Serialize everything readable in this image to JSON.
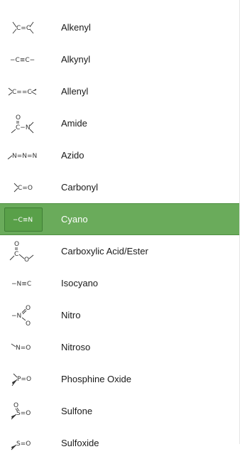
{
  "list": {
    "selected_index": 6,
    "items": [
      {
        "label": "Alkenyl",
        "icon": "alkenyl-icon"
      },
      {
        "label": "Alkynyl",
        "icon": "alkynyl-icon"
      },
      {
        "label": "Allenyl",
        "icon": "allenyl-icon"
      },
      {
        "label": "Amide",
        "icon": "amide-icon"
      },
      {
        "label": "Azido",
        "icon": "azido-icon"
      },
      {
        "label": "Carbonyl",
        "icon": "carbonyl-icon"
      },
      {
        "label": "Cyano",
        "icon": "cyano-icon"
      },
      {
        "label": "Carboxylic Acid/Ester",
        "icon": "carboxylic-acid-ester-icon"
      },
      {
        "label": "Isocyano",
        "icon": "isocyano-icon"
      },
      {
        "label": "Nitro",
        "icon": "nitro-icon"
      },
      {
        "label": "Nitroso",
        "icon": "nitroso-icon"
      },
      {
        "label": "Phosphine Oxide",
        "icon": "phosphine-oxide-icon"
      },
      {
        "label": "Sulfone",
        "icon": "sulfone-icon"
      },
      {
        "label": "Sulfoxide",
        "icon": "sulfoxide-icon"
      }
    ]
  },
  "icon_text": {
    "alkenyl": "C=C",
    "alkynyl": "−C≡C−",
    "allenyl": "C==C",
    "amide_o": "O",
    "amide_main": "C−N",
    "azido": "N=N=N",
    "carbonyl": "C=O",
    "cyano": "−C≡N",
    "carboxylic_o1": "O",
    "carboxylic_c": "C",
    "carboxylic_o2": "O",
    "isocyano": "−N≡C",
    "nitro_n": "−N",
    "nitro_o1": "O",
    "nitro_o2": "O",
    "nitroso": "N=O",
    "phosphine_oxide": "P=O",
    "sulfone_o": "O",
    "sulfone_main": "S=O",
    "sulfoxide": "S=O"
  },
  "colors": {
    "selected_row": "#6aab5b",
    "selected_icon_bg": "#59a049",
    "text": "#1a1a1a",
    "selected_text": "#ffffff"
  }
}
